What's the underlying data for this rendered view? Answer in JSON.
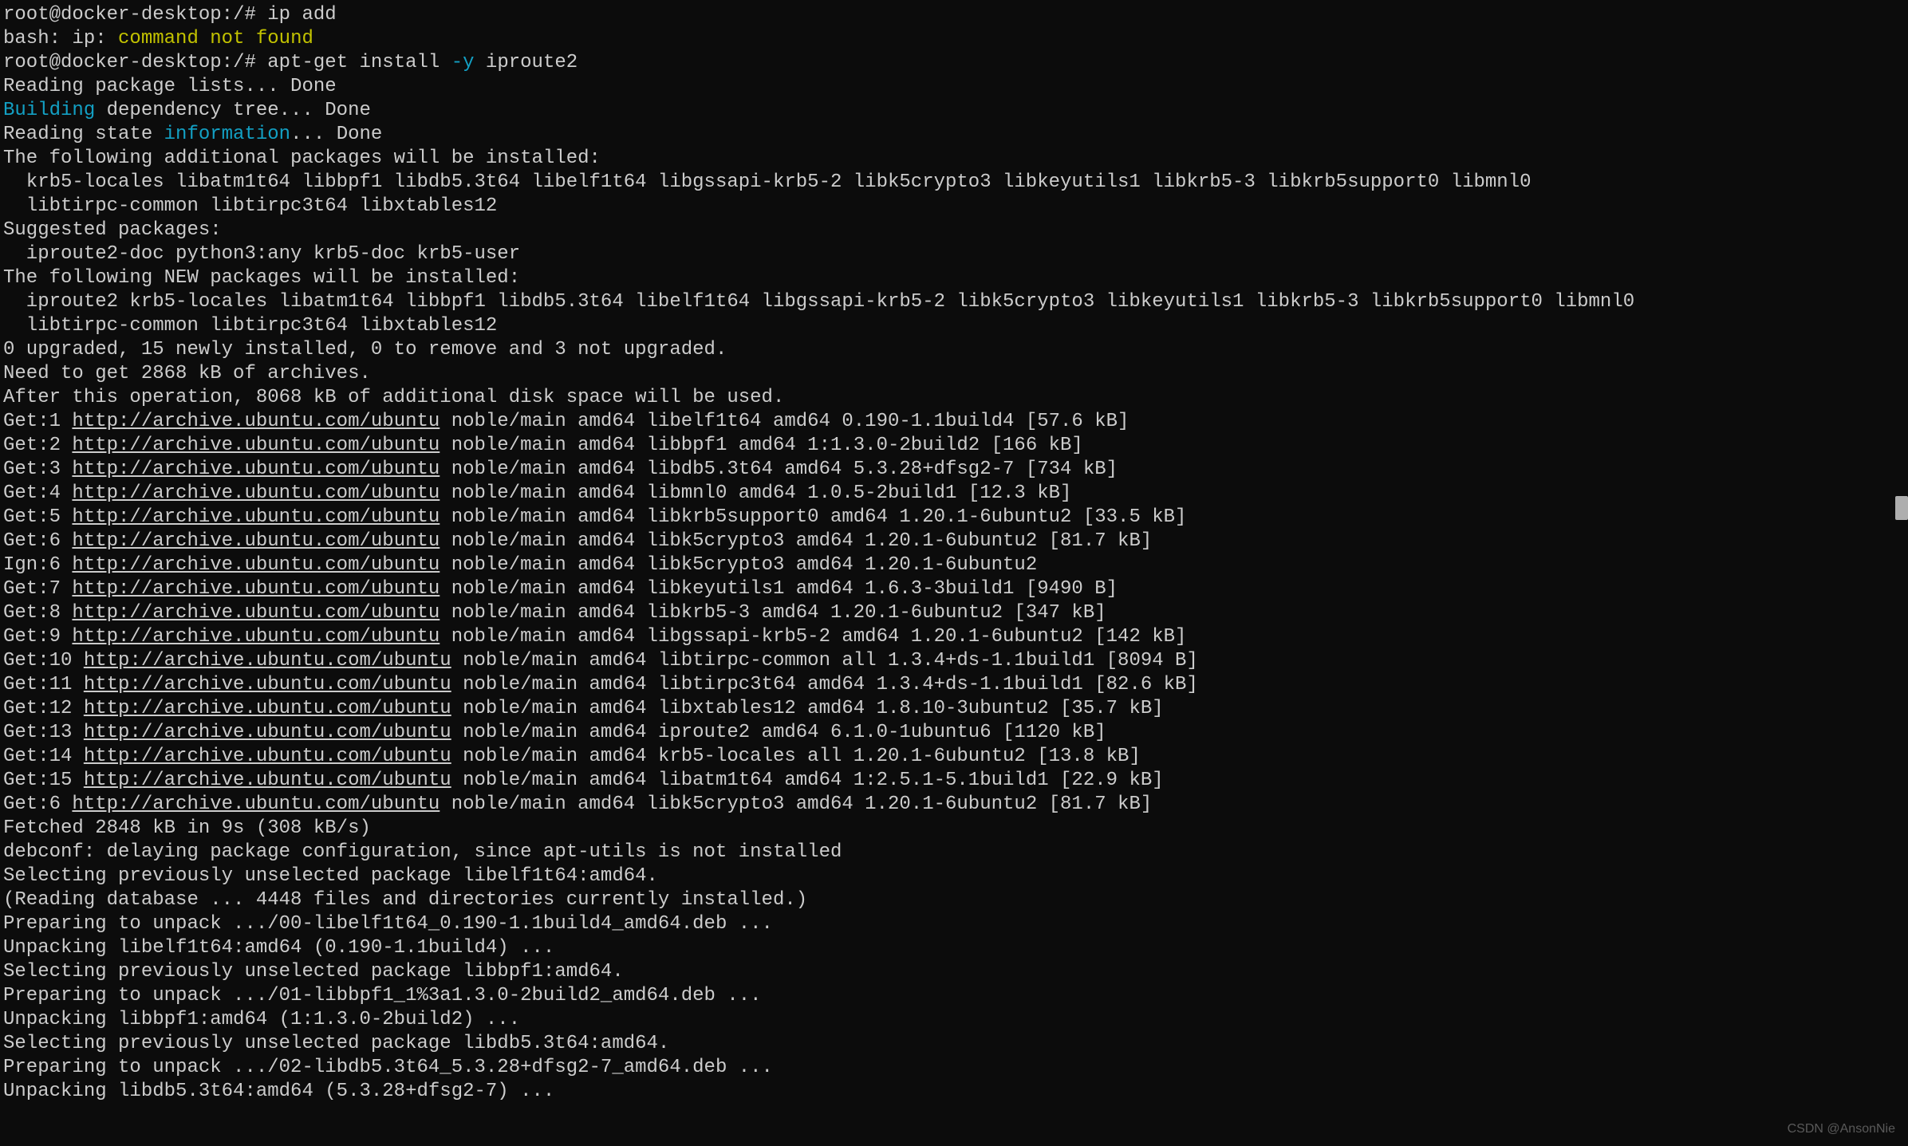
{
  "prompt_user": "root@docker-desktop",
  "prompt_sep": ":",
  "prompt_path": "/#",
  "cmd1": "ip add",
  "bash_prefix": "bash: ip: ",
  "bash_err": "command not found",
  "cmd2_a": "apt-get install ",
  "cmd2_flag": "-y",
  "cmd2_b": " iproute2",
  "l_read_pkg": "Reading package lists... Done",
  "build_word": "Building",
  "build_rest": " dependency tree... Done",
  "read_state_a": "Reading state ",
  "info_word": "information",
  "read_state_b": "... Done",
  "l_addl": "The following additional packages will be installed:",
  "l_addl_pkgs1": "  krb5-locales libatm1t64 libbpf1 libdb5.3t64 libelf1t64 libgssapi-krb5-2 libk5crypto3 libkeyutils1 libkrb5-3 libkrb5support0 libmnl0",
  "l_addl_pkgs2": "  libtirpc-common libtirpc3t64 libxtables12",
  "l_sugg": "Suggested packages:",
  "l_sugg_pkgs": "  iproute2-doc python3:any krb5-doc krb5-user",
  "l_new": "The following NEW packages will be installed:",
  "l_new_pkgs1": "  iproute2 krb5-locales libatm1t64 libbpf1 libdb5.3t64 libelf1t64 libgssapi-krb5-2 libk5crypto3 libkeyutils1 libkrb5-3 libkrb5support0 libmnl0",
  "l_new_pkgs2": "  libtirpc-common libtirpc3t64 libxtables12",
  "l_upgraded": "0 upgraded, 15 newly installed, 0 to remove and 3 not upgraded.",
  "l_need": "Need to get 2868 kB of archives.",
  "l_after": "After this operation, 8068 kB of additional disk space will be used.",
  "repo_url": "http://archive.ubuntu.com/ubuntu",
  "gets": [
    {
      "pre": "Get:1 ",
      "post": " noble/main amd64 libelf1t64 amd64 0.190-1.1build4 [57.6 kB]"
    },
    {
      "pre": "Get:2 ",
      "post": " noble/main amd64 libbpf1 amd64 1:1.3.0-2build2 [166 kB]"
    },
    {
      "pre": "Get:3 ",
      "post": " noble/main amd64 libdb5.3t64 amd64 5.3.28+dfsg2-7 [734 kB]"
    },
    {
      "pre": "Get:4 ",
      "post": " noble/main amd64 libmnl0 amd64 1.0.5-2build1 [12.3 kB]"
    },
    {
      "pre": "Get:5 ",
      "post": " noble/main amd64 libkrb5support0 amd64 1.20.1-6ubuntu2 [33.5 kB]"
    },
    {
      "pre": "Get:6 ",
      "post": " noble/main amd64 libk5crypto3 amd64 1.20.1-6ubuntu2 [81.7 kB]"
    },
    {
      "pre": "Ign:6 ",
      "post": " noble/main amd64 libk5crypto3 amd64 1.20.1-6ubuntu2"
    },
    {
      "pre": "Get:7 ",
      "post": " noble/main amd64 libkeyutils1 amd64 1.6.3-3build1 [9490 B]"
    },
    {
      "pre": "Get:8 ",
      "post": " noble/main amd64 libkrb5-3 amd64 1.20.1-6ubuntu2 [347 kB]"
    },
    {
      "pre": "Get:9 ",
      "post": " noble/main amd64 libgssapi-krb5-2 amd64 1.20.1-6ubuntu2 [142 kB]"
    },
    {
      "pre": "Get:10 ",
      "post": " noble/main amd64 libtirpc-common all 1.3.4+ds-1.1build1 [8094 B]"
    },
    {
      "pre": "Get:11 ",
      "post": " noble/main amd64 libtirpc3t64 amd64 1.3.4+ds-1.1build1 [82.6 kB]"
    },
    {
      "pre": "Get:12 ",
      "post": " noble/main amd64 libxtables12 amd64 1.8.10-3ubuntu2 [35.7 kB]"
    },
    {
      "pre": "Get:13 ",
      "post": " noble/main amd64 iproute2 amd64 6.1.0-1ubuntu6 [1120 kB]"
    },
    {
      "pre": "Get:14 ",
      "post": " noble/main amd64 krb5-locales all 1.20.1-6ubuntu2 [13.8 kB]"
    },
    {
      "pre": "Get:15 ",
      "post": " noble/main amd64 libatm1t64 amd64 1:2.5.1-5.1build1 [22.9 kB]"
    },
    {
      "pre": "Get:6 ",
      "post": " noble/main amd64 libk5crypto3 amd64 1.20.1-6ubuntu2 [81.7 kB]"
    }
  ],
  "l_fetched": "Fetched 2848 kB in 9s (308 kB/s)",
  "l_debconf": "debconf: delaying package configuration, since apt-utils is not installed",
  "tail": [
    "Selecting previously unselected package libelf1t64:amd64.",
    "(Reading database ... 4448 files and directories currently installed.)",
    "Preparing to unpack .../00-libelf1t64_0.190-1.1build4_amd64.deb ...",
    "Unpacking libelf1t64:amd64 (0.190-1.1build4) ...",
    "Selecting previously unselected package libbpf1:amd64.",
    "Preparing to unpack .../01-libbpf1_1%3a1.3.0-2build2_amd64.deb ...",
    "Unpacking libbpf1:amd64 (1:1.3.0-2build2) ...",
    "Selecting previously unselected package libdb5.3t64:amd64.",
    "Preparing to unpack .../02-libdb5.3t64_5.3.28+dfsg2-7_amd64.deb ...",
    "Unpacking libdb5.3t64:amd64 (5.3.28+dfsg2-7) ..."
  ],
  "watermark": "CSDN @AnsonNie"
}
